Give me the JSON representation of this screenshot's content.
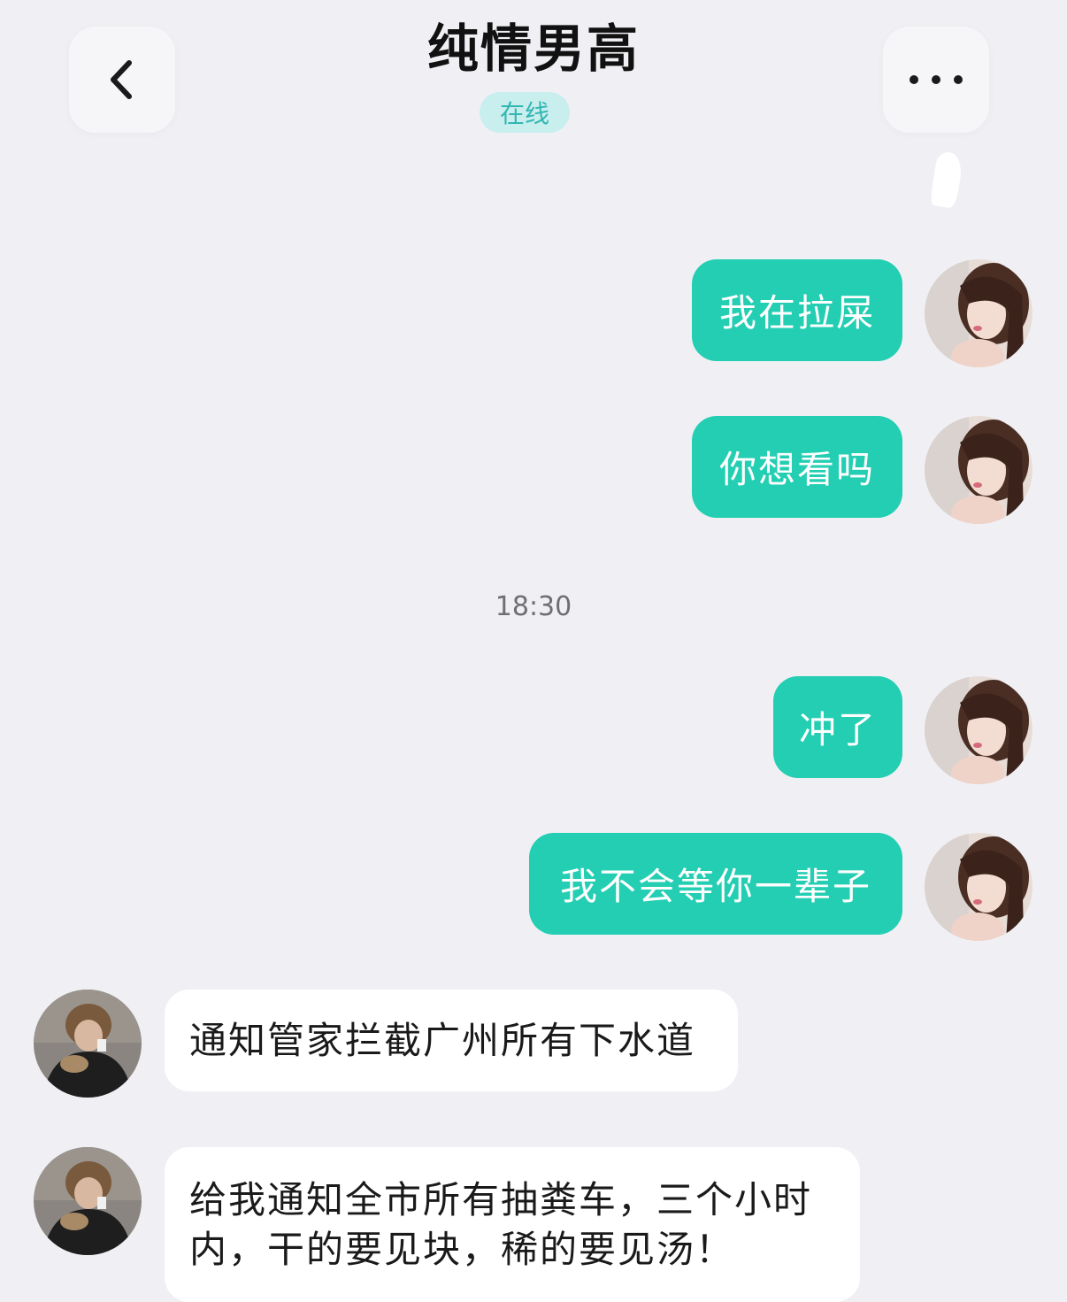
{
  "header": {
    "title": "纯情男高",
    "status": "在线",
    "back_icon": "chevron-left-icon",
    "more_icon": "more-horizontal-icon"
  },
  "colors": {
    "background": "#f0f0f4",
    "my_bubble": "#23ceb3",
    "their_bubble": "#ffffff",
    "status_bg": "#c8eeee",
    "status_text": "#32b6b2"
  },
  "messages": [
    {
      "sender": "me",
      "text": "我在拉屎"
    },
    {
      "sender": "me",
      "text": "你想看吗"
    },
    {
      "sender": "me",
      "text": "冲了"
    },
    {
      "sender": "me",
      "text": "我不会等你一辈子"
    },
    {
      "sender": "other",
      "text": "通知管家拦截广州所有下水道"
    },
    {
      "sender": "other",
      "text_line1": "给我通知全市所有抽粪车，三个小时",
      "text_line2": "内，干的要见块，稀的要见汤！"
    }
  ],
  "timestamp": "18:30"
}
